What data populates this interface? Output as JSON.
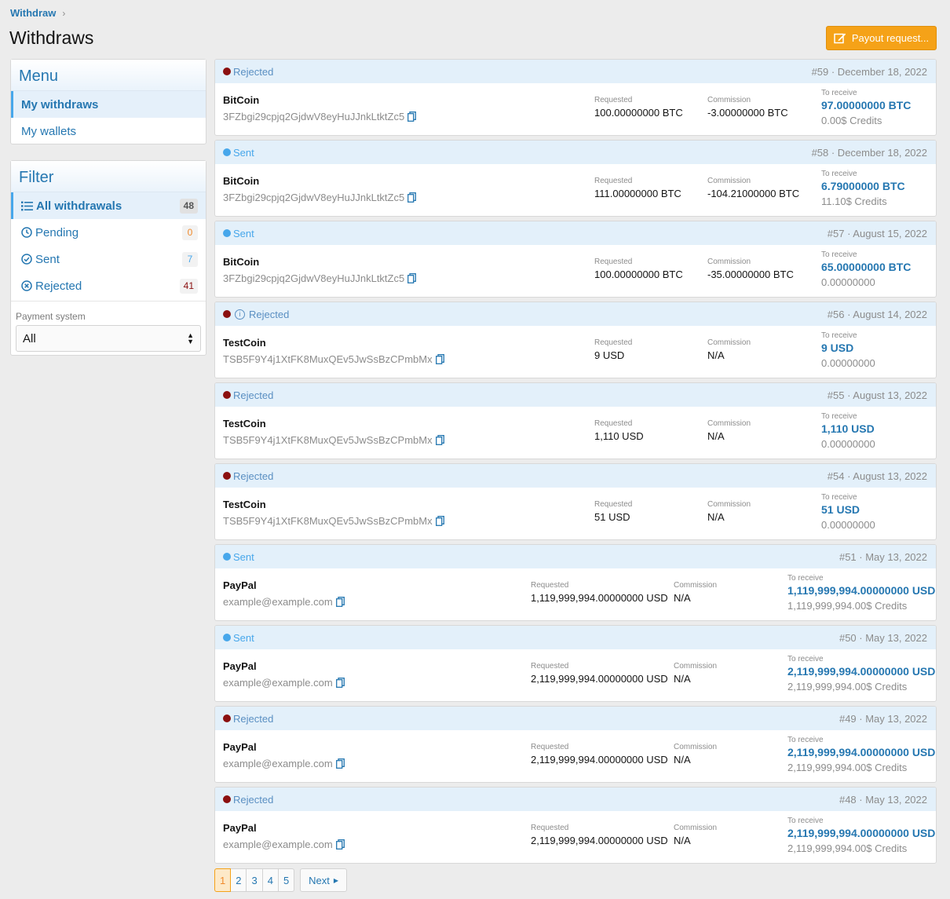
{
  "breadcrumb": {
    "label": "Withdraw"
  },
  "page": {
    "title": "Withdraws",
    "payout_button": "Payout request..."
  },
  "menu": {
    "title": "Menu",
    "items": [
      {
        "label": "My withdraws",
        "active": true
      },
      {
        "label": "My wallets",
        "active": false
      }
    ]
  },
  "filter": {
    "title": "Filter",
    "items": [
      {
        "label": "All withdrawals",
        "count": "48",
        "icon": "list-icon",
        "active": true
      },
      {
        "label": "Pending",
        "count": "0",
        "icon": "clock-icon"
      },
      {
        "label": "Sent",
        "count": "7",
        "icon": "check-circle-icon"
      },
      {
        "label": "Rejected",
        "count": "41",
        "icon": "x-circle-icon"
      }
    ],
    "payment_system_label": "Payment system",
    "payment_system_value": "All"
  },
  "labels": {
    "requested": "Requested",
    "commission": "Commission",
    "to_receive": "To receive"
  },
  "withdrawals": [
    {
      "status": "Rejected",
      "status_type": "rejected",
      "meta": "#59 · December 18, 2022",
      "name": "BitCoin",
      "wallet": "3FZbgi29cpjq2GjdwV8eyHuJJnkLtktZc5",
      "requested": "100.00000000 BTC",
      "commission": "-3.00000000 BTC",
      "receive": "97.00000000 BTC",
      "receive_sub": "0.00$ Credits",
      "layout": "crypto"
    },
    {
      "status": "Sent",
      "status_type": "sent",
      "meta": "#58 · December 18, 2022",
      "name": "BitCoin",
      "wallet": "3FZbgi29cpjq2GjdwV8eyHuJJnkLtktZc5",
      "requested": "111.00000000 BTC",
      "commission": "-104.21000000 BTC",
      "receive": "6.79000000 BTC",
      "receive_sub": "11.10$ Credits",
      "layout": "crypto"
    },
    {
      "status": "Sent",
      "status_type": "sent",
      "meta": "#57 · August 15, 2022",
      "name": "BitCoin",
      "wallet": "3FZbgi29cpjq2GjdwV8eyHuJJnkLtktZc5",
      "requested": "100.00000000 BTC",
      "commission": "-35.00000000 BTC",
      "receive": "65.00000000 BTC",
      "receive_sub": "0.00000000",
      "layout": "crypto"
    },
    {
      "status": "Rejected",
      "status_type": "rejected",
      "info": true,
      "meta": "#56 · August 14, 2022",
      "name": "TestCoin",
      "wallet": "TSB5F9Y4j1XtFK8MuxQEv5JwSsBzCPmbMx",
      "requested": "9 USD",
      "commission": "N/A",
      "receive": "9 USD",
      "receive_sub": "0.00000000",
      "layout": "crypto"
    },
    {
      "status": "Rejected",
      "status_type": "rejected",
      "meta": "#55 · August 13, 2022",
      "name": "TestCoin",
      "wallet": "TSB5F9Y4j1XtFK8MuxQEv5JwSsBzCPmbMx",
      "requested": "1,110 USD",
      "commission": "N/A",
      "receive": "1,110 USD",
      "receive_sub": "0.00000000",
      "layout": "crypto"
    },
    {
      "status": "Rejected",
      "status_type": "rejected",
      "meta": "#54 · August 13, 2022",
      "name": "TestCoin",
      "wallet": "TSB5F9Y4j1XtFK8MuxQEv5JwSsBzCPmbMx",
      "requested": "51 USD",
      "commission": "N/A",
      "receive": "51 USD",
      "receive_sub": "0.00000000",
      "layout": "crypto"
    },
    {
      "status": "Sent",
      "status_type": "sent",
      "meta": "#51 · May 13, 2022",
      "name": "PayPal",
      "wallet": "example@example.com",
      "requested": "1,119,999,994.00000000 USD",
      "commission": "N/A",
      "receive": "1,119,999,994.00000000 USD",
      "receive_sub": "1,119,999,994.00$ Credits",
      "layout": "wide"
    },
    {
      "status": "Sent",
      "status_type": "sent",
      "meta": "#50 · May 13, 2022",
      "name": "PayPal",
      "wallet": "example@example.com",
      "requested": "2,119,999,994.00000000 USD",
      "commission": "N/A",
      "receive": "2,119,999,994.00000000 USD",
      "receive_sub": "2,119,999,994.00$ Credits",
      "layout": "wide"
    },
    {
      "status": "Rejected",
      "status_type": "rejected",
      "meta": "#49 · May 13, 2022",
      "name": "PayPal",
      "wallet": "example@example.com",
      "requested": "2,119,999,994.00000000 USD",
      "commission": "N/A",
      "receive": "2,119,999,994.00000000 USD",
      "receive_sub": "2,119,999,994.00$ Credits",
      "layout": "wide"
    },
    {
      "status": "Rejected",
      "status_type": "rejected",
      "meta": "#48 · May 13, 2022",
      "name": "PayPal",
      "wallet": "example@example.com",
      "requested": "2,119,999,994.00000000 USD",
      "commission": "N/A",
      "receive": "2,119,999,994.00000000 USD",
      "receive_sub": "2,119,999,994.00$ Credits",
      "layout": "wide"
    }
  ],
  "pagination": {
    "pages": [
      "1",
      "2",
      "3",
      "4",
      "5"
    ],
    "current": "1",
    "next": "Next"
  },
  "colors": {
    "accent": "#2577b1",
    "button": "#f5a218",
    "sent": "#47a7eb",
    "rejected": "#8b1010",
    "pending": "#f08a2c"
  }
}
